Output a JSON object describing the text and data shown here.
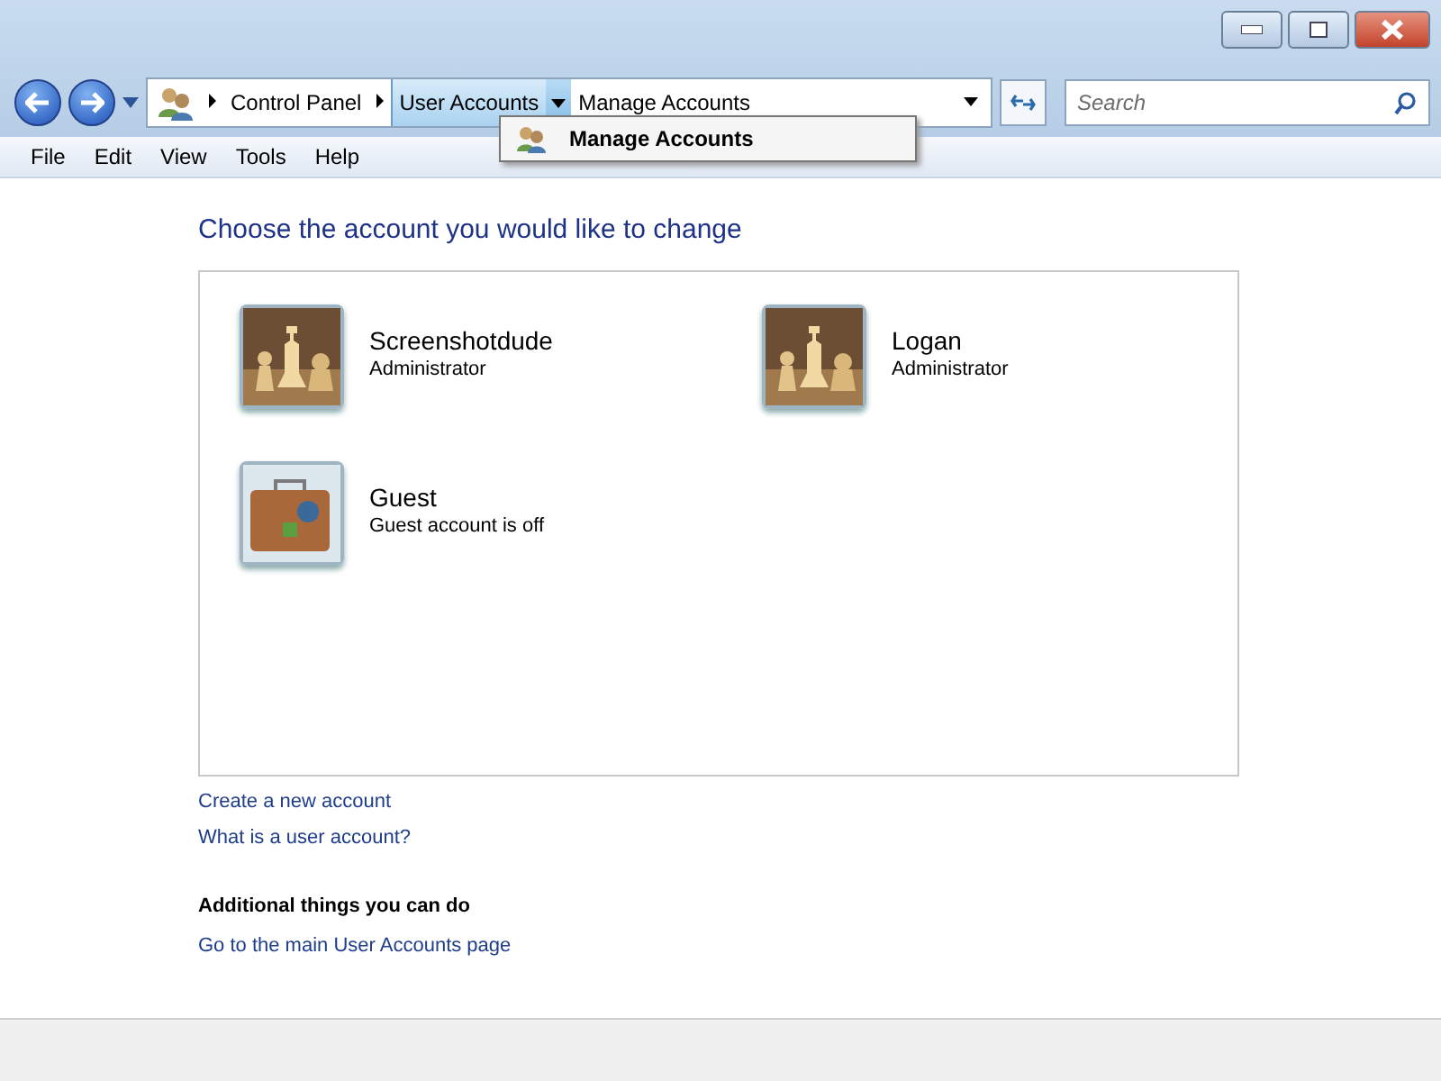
{
  "address_bar": {
    "crumbs": [
      {
        "label": "Control Panel",
        "selected": false
      },
      {
        "label": "User Accounts",
        "selected": true
      },
      {
        "label": "Manage Accounts",
        "selected": false
      }
    ]
  },
  "search": {
    "placeholder": "Search"
  },
  "dropdown": {
    "items": [
      {
        "label": "Manage Accounts"
      }
    ]
  },
  "menu": [
    "File",
    "Edit",
    "View",
    "Tools",
    "Help"
  ],
  "heading": "Choose the account you would like to change",
  "accounts": [
    {
      "name": "Screenshotdude",
      "role": "Administrator",
      "kind": "chess"
    },
    {
      "name": "Logan",
      "role": "Administrator",
      "kind": "chess"
    },
    {
      "name": "Guest",
      "role": "Guest account is off",
      "kind": "suitcase"
    }
  ],
  "links": [
    "Create a new account",
    "What is a user account?"
  ],
  "additional": {
    "title": "Additional things you can do",
    "links": [
      "Go to the main User Accounts page"
    ]
  }
}
